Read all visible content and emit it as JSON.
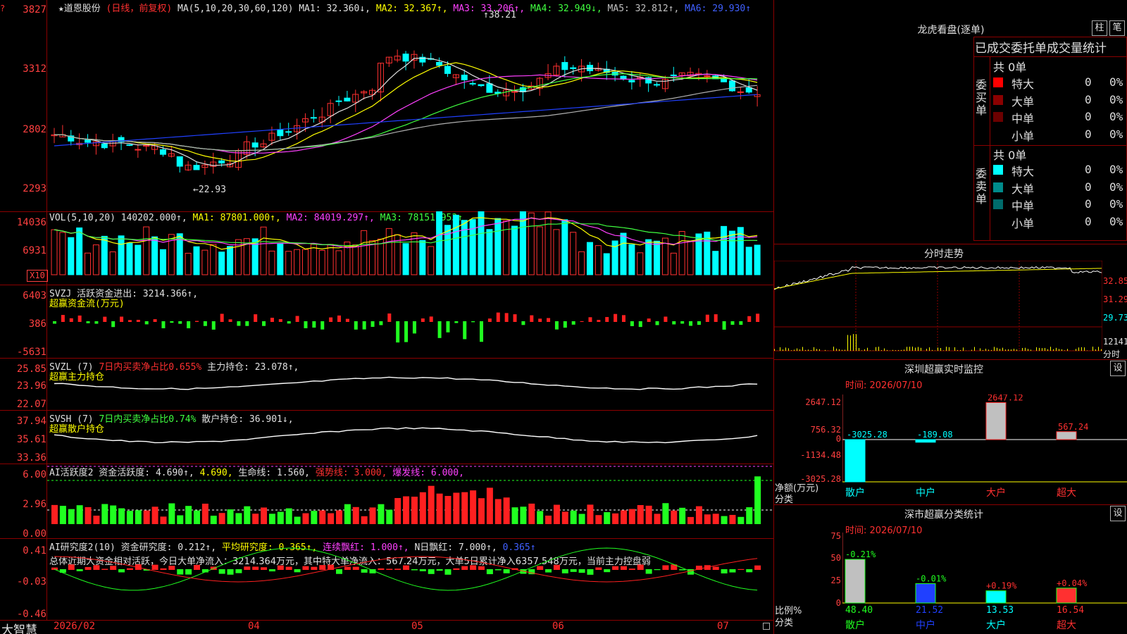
{
  "header": {
    "stock_title": "★道恩股份",
    "period": "(日线，前复权)",
    "ma_label": "MA(5,10,20,30,60,120)",
    "ma1": "MA1: 32.360↓,",
    "ma2": "MA2: 32.367↑,",
    "ma3": "MA3: 33.206↑,",
    "ma4": "MA4: 32.949↓,",
    "ma5": "MA5: 32.812↑,",
    "ma6": "MA6: 29.930↑"
  },
  "main_axis": [
    "3827",
    "3312",
    "2802",
    "2293"
  ],
  "price_annotations": {
    "high": "38.21",
    "low": "22.93"
  },
  "vol_panel": {
    "title": "VOL(5,10,20)",
    "value": "140202.000↑,",
    "ma1": "MA1: 87801.000↑,",
    "ma2": "MA2: 84019.297↑,",
    "ma3": "MA3: 78151.953↑",
    "axis": [
      "14036",
      "6931"
    ],
    "unit": "X10"
  },
  "svzj_panel": {
    "line1": "SVZJ  活跃资金进出: 3214.366↑,",
    "line2": "超赢资金流(万元)",
    "axis": [
      "6403",
      "386",
      "-5631"
    ]
  },
  "svzl_panel": {
    "name": "SVZL (7)",
    "pct": "7日内买卖净占比0.655%",
    "hold": "主力持仓: 23.078↑,",
    "sub": "超赢主力持仓",
    "axis": [
      "25.85",
      "23.96",
      "22.07"
    ]
  },
  "svsh_panel": {
    "name": "SVSH (7)",
    "pct": "7日内买卖净占比0.74%",
    "hold": "散户持仓: 36.901↓,",
    "sub": "超赢散户持仓",
    "axis": [
      "37.94",
      "35.61",
      "33.36"
    ]
  },
  "ai1_panel": {
    "a": "AI活跃度2 资金活跃度: 4.690↑,",
    "b": "4.690,",
    "c": "生命线: 1.560,",
    "d": "强势线: 3.000,",
    "e": "爆发线: 6.000,",
    "axis": [
      "6.00",
      "2.96",
      "0.00"
    ]
  },
  "ai2_panel": {
    "a": "AI研究度2(10) 资金研究度: 0.212↑,",
    "b": "平均研究度: 0.365↑,",
    "c": "连续飘红: 1.000↑,",
    "d": "N日飘红: 7.000↑,",
    "e": "0.365↑",
    "summary": "总体近期大资金相对活跃，今日大单净流入：3214.364万元，其中特大单净流入：567.24万元，大单5日累计净入6357.548万元，当前主力控盘弱",
    "axis": [
      "0.41",
      "-0.03",
      "-0.46"
    ]
  },
  "footer": {
    "brand": "大智慧",
    "months": [
      "2026/02",
      "04",
      "05",
      "06",
      "07"
    ]
  },
  "right_panel": {
    "lhb_title": "龙虎看盘(逐单)",
    "btn_zhu": "柱",
    "btn_bi": "笔",
    "table_header": "已成交委托单成交量统计",
    "buy_side": "委买单",
    "sell_side": "委卖单",
    "buy_total": "共 0单",
    "sell_total": "共 0单",
    "buy_rows": [
      {
        "label": "特大",
        "v1": "0",
        "v2": "0%",
        "color": "#ff0000"
      },
      {
        "label": "大单",
        "v1": "0",
        "v2": "0%",
        "color": "#8b0000"
      },
      {
        "label": "中单",
        "v1": "0",
        "v2": "0%",
        "color": "#6b0000"
      },
      {
        "label": "小单",
        "v1": "0",
        "v2": "0%",
        "color": "#000000"
      }
    ],
    "sell_rows": [
      {
        "label": "特大",
        "v1": "0",
        "v2": "0%",
        "color": "#00ffff"
      },
      {
        "label": "大单",
        "v1": "0",
        "v2": "0%",
        "color": "#008b8b"
      },
      {
        "label": "中单",
        "v1": "0",
        "v2": "0%",
        "color": "#006b6b"
      },
      {
        "label": "小单",
        "v1": "0",
        "v2": "0%",
        "color": "#000000"
      }
    ],
    "intraday_title": "分时走势",
    "intraday_axis": [
      "32.85",
      "31.29",
      "29.73",
      "12141",
      "分时"
    ],
    "sz_monitor_title": "深圳超赢实时监控",
    "sz_monitor_btn": "设",
    "sz_time": "时间: 2026/07/10",
    "sz_axis": [
      "2647.12",
      "756.32",
      "0",
      "-1134.48",
      "-3025.28"
    ],
    "sz_ylabel": "净额(万元)",
    "sz_xlabel": "分类",
    "sz_cats": [
      "散户",
      "中户",
      "大户",
      "超大"
    ],
    "sz_values_text": [
      "-3025.28",
      "-189.08",
      "2647.12",
      "567.24"
    ],
    "sz_class_title": "深市超赢分类统计",
    "sz_class_btn": "设",
    "cls_time": "时间: 2026/07/10",
    "cls_axis": [
      "75",
      "50",
      "25",
      "0"
    ],
    "cls_ylabel": "比例%",
    "cls_xlabel": "分类",
    "cls_cats": [
      "散户",
      "中户",
      "大户",
      "超大"
    ],
    "cls_bottom": [
      "48.40",
      "21.52",
      "13.53",
      "16.54"
    ],
    "cls_top": [
      "-0.21%",
      "-0.01%",
      "+0.19%",
      "+0.04%"
    ]
  },
  "chart_data": [
    {
      "type": "bar",
      "title": "深圳超赢实时监控",
      "categories": [
        "散户",
        "中户",
        "大户",
        "超大"
      ],
      "values": [
        -3025.28,
        -189.08,
        2647.12,
        567.24
      ],
      "ylabel": "净额(万元)",
      "xlabel": "分类",
      "ylim": [
        -3025.28,
        2647.12
      ]
    },
    {
      "type": "bar",
      "title": "深市超赢分类统计",
      "categories": [
        "散户",
        "中户",
        "大户",
        "超大"
      ],
      "values": [
        48.4,
        21.52,
        13.53,
        16.54
      ],
      "changes": [
        "-0.21%",
        "-0.01%",
        "+0.19%",
        "+0.04%"
      ],
      "ylabel": "比例%",
      "xlabel": "分类",
      "ylim": [
        0,
        75
      ]
    }
  ]
}
